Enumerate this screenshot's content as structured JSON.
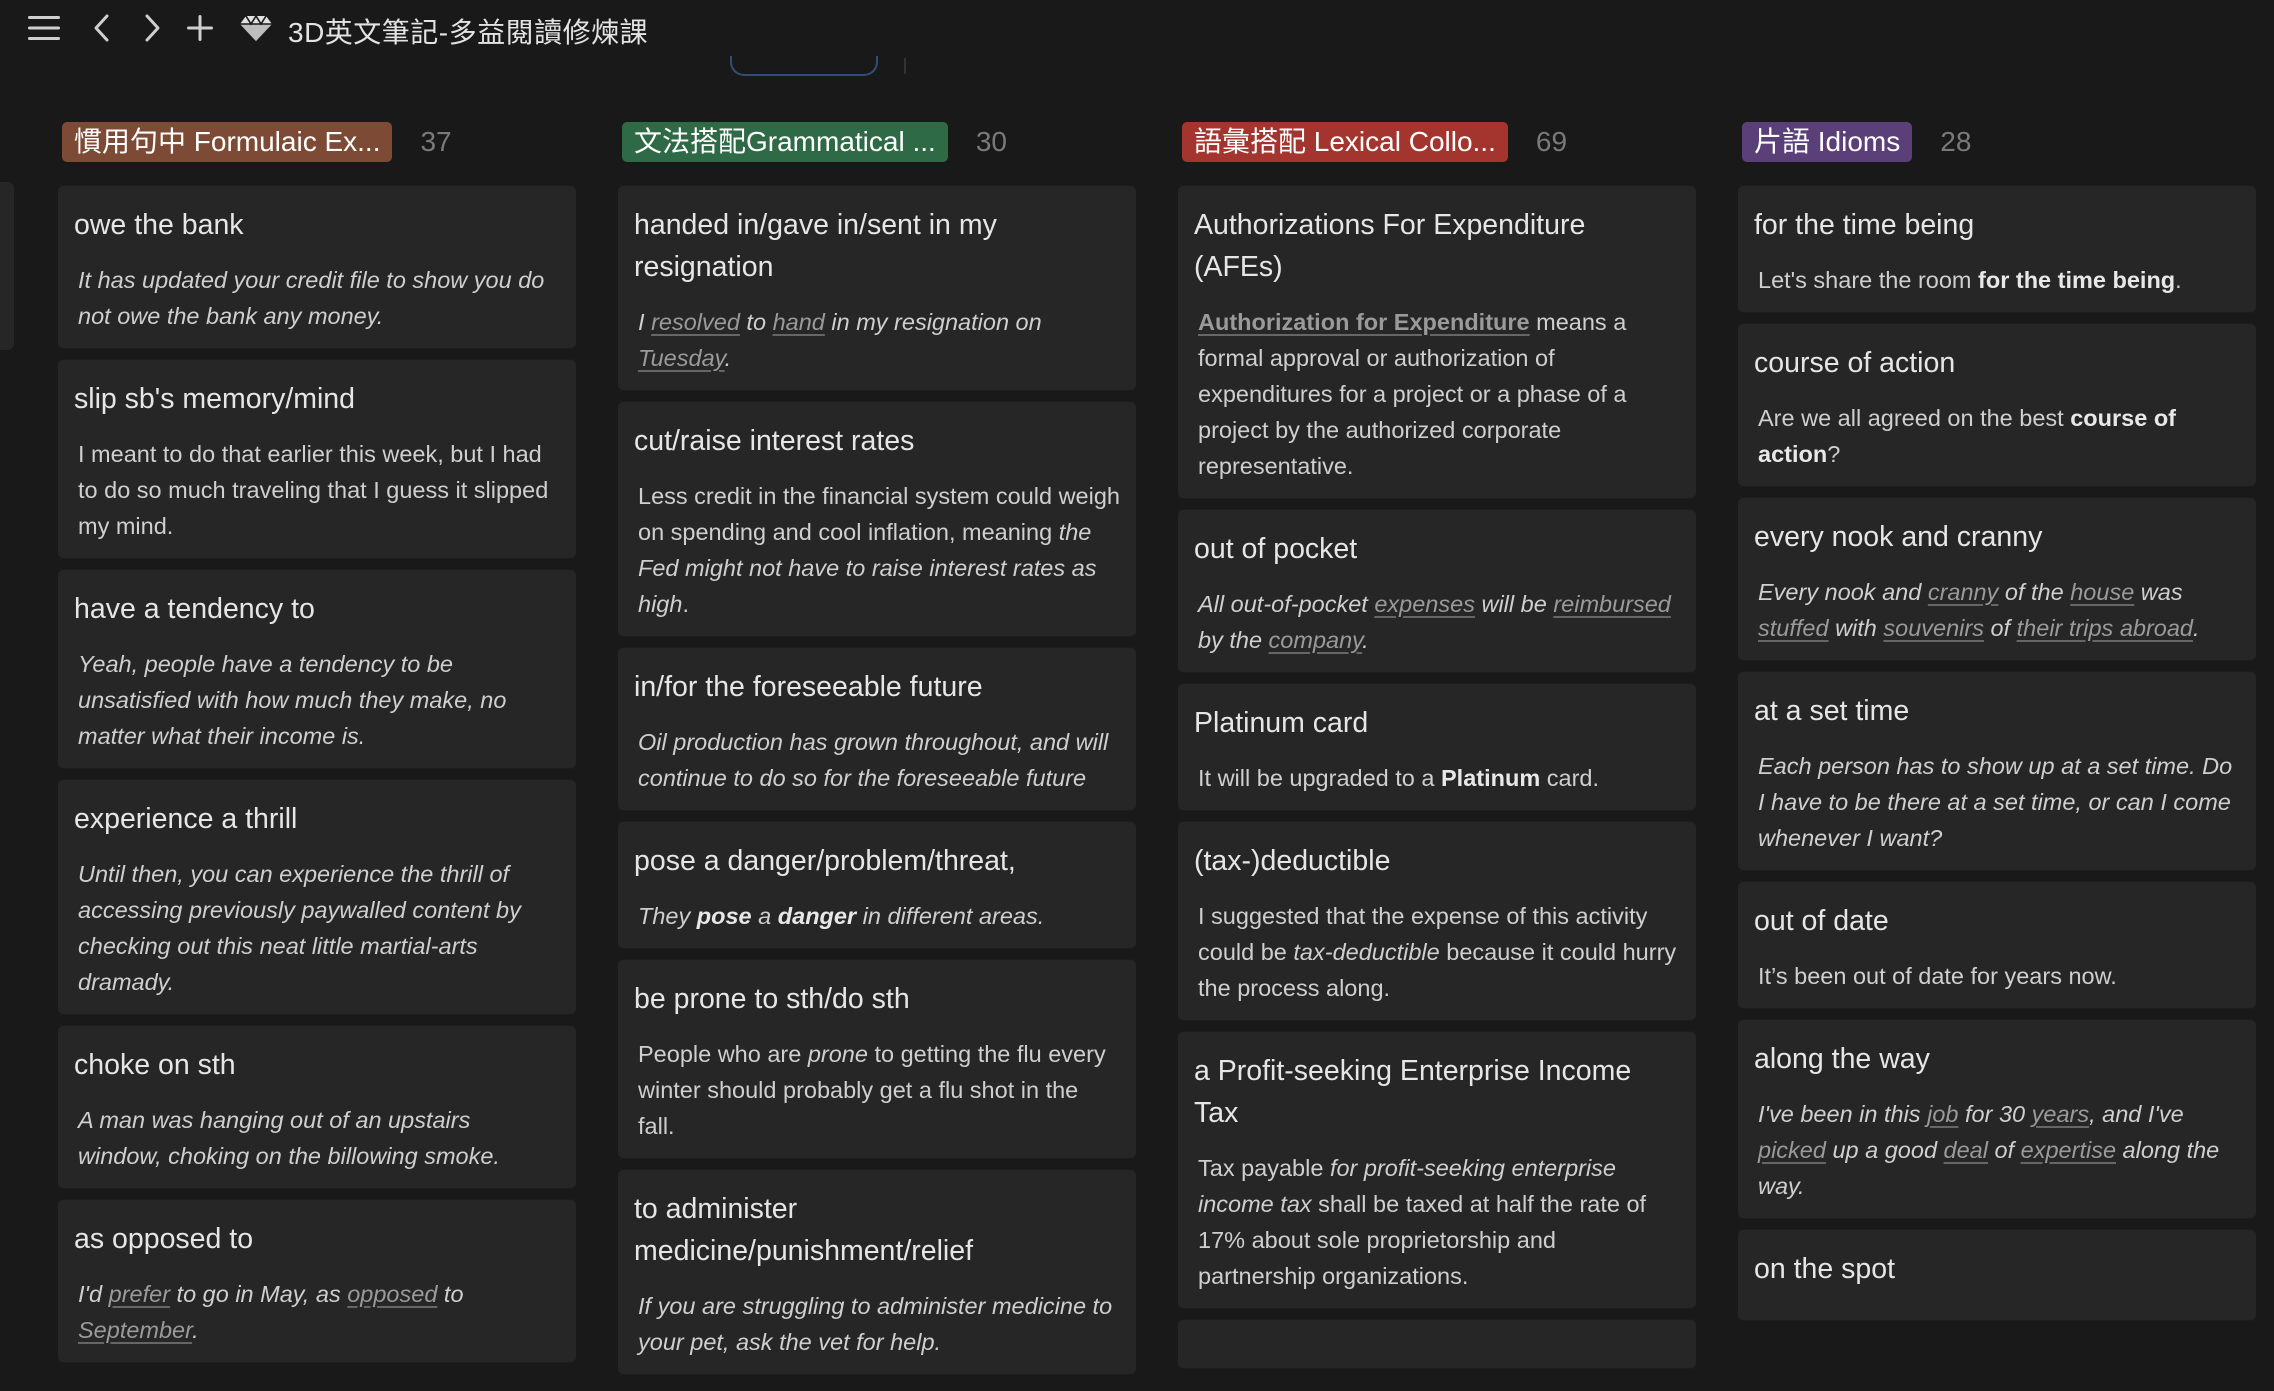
{
  "app": {
    "title": "3D英文筆記-多益閱讀修煉課",
    "menu_icon": "menu-icon",
    "back_icon": "chevron-left-icon",
    "forward_icon": "chevron-right-icon",
    "new_icon": "plus-icon",
    "page_icon": "gem-icon"
  },
  "columns": [
    {
      "tag": "慣用句中 Formulaic Ex...",
      "count": "37",
      "color": "#7d4a36",
      "cards": [
        {
          "title": "owe the bank",
          "style": "italic",
          "body": [
            {
              "t": "It has updated your credit file to show you do not owe the bank any money."
            }
          ]
        },
        {
          "title": "slip sb's memory/mind",
          "style": "plain",
          "body": [
            {
              "t": "I meant to do that earlier this week, but I had to do so much traveling that I guess it slipped my mind."
            }
          ]
        },
        {
          "title": "have a tendency to",
          "style": "italic",
          "body": [
            {
              "t": "Yeah, people have a tendency to be unsatisfied with how much they make, no matter what their income is."
            }
          ]
        },
        {
          "title": "experience a thrill",
          "style": "italic",
          "body": [
            {
              "t": "Until then, you can experience the thrill of accessing previously paywalled content by checking out this neat little martial-arts dramady."
            }
          ]
        },
        {
          "title": "choke on sth",
          "style": "italic",
          "body": [
            {
              "t": "A man was hanging out of an upstairs window, choking on the billowing smoke."
            }
          ]
        },
        {
          "title": "as opposed to",
          "style": "italic",
          "body": [
            {
              "t": "I'd "
            },
            {
              "t": "prefer",
              "f": "u"
            },
            {
              "t": " to go in May, as "
            },
            {
              "t": "opposed",
              "f": "u"
            },
            {
              "t": " to "
            },
            {
              "t": "September",
              "f": "u"
            },
            {
              "t": "."
            }
          ]
        }
      ]
    },
    {
      "tag": "文法搭配Grammatical ...",
      "count": "30",
      "color": "#2f6a46",
      "cards": [
        {
          "title": "handed in/gave in/sent in my resignation",
          "style": "italic",
          "body": [
            {
              "t": "I "
            },
            {
              "t": "resolved",
              "f": "u"
            },
            {
              "t": " to "
            },
            {
              "t": "hand",
              "f": "u"
            },
            {
              "t": " in my resignation on "
            },
            {
              "t": "Tuesday",
              "f": "u"
            },
            {
              "t": "."
            }
          ]
        },
        {
          "title": "cut/raise interest rates",
          "style": "plain",
          "body": [
            {
              "t": "Less credit in the financial system could weigh on spending and cool inflation, meaning "
            },
            {
              "t": "the Fed might not have to raise interest rates as high",
              "f": "i"
            },
            {
              "t": "."
            }
          ]
        },
        {
          "title": "in/for the foreseeable future",
          "style": "italic",
          "body": [
            {
              "t": "Oil production has grown throughout, and will continue to do so for the foreseeable future"
            }
          ]
        },
        {
          "title": "pose a danger/problem/threat,",
          "style": "italic",
          "body": [
            {
              "t": "They "
            },
            {
              "t": "pose",
              "f": "b"
            },
            {
              "t": " a "
            },
            {
              "t": "danger",
              "f": "b"
            },
            {
              "t": " in different areas."
            }
          ]
        },
        {
          "title": "be prone to sth/do sth",
          "style": "plain",
          "body": [
            {
              "t": "People who are "
            },
            {
              "t": "prone",
              "f": "i"
            },
            {
              "t": " to getting the flu every winter should probably get a flu shot in the fall."
            }
          ]
        },
        {
          "title": "to administer medicine/punishment/relief",
          "style": "italic",
          "body": [
            {
              "t": "If you are struggling to administer medicine to your pet, ask the vet for help."
            }
          ]
        }
      ]
    },
    {
      "tag": "語彙搭配 Lexical Collo...",
      "count": "69",
      "color": "#a3352e",
      "cards": [
        {
          "title": "Authorizations For Expenditure (AFEs)",
          "style": "plain",
          "body": [
            {
              "t": "Authorization for Expenditure",
              "f": "ul"
            },
            {
              "t": " means a formal approval or authorization of expenditures for a project or a phase of a project by the authorized corporate representative."
            }
          ]
        },
        {
          "title": "out of pocket",
          "style": "italic",
          "body": [
            {
              "t": "All out-of-pocket "
            },
            {
              "t": "expenses",
              "f": "u"
            },
            {
              "t": " will be "
            },
            {
              "t": "reimbursed",
              "f": "u"
            },
            {
              "t": " by the "
            },
            {
              "t": "company",
              "f": "u"
            },
            {
              "t": "."
            }
          ]
        },
        {
          "title": "Platinum card",
          "style": "plain",
          "body": [
            {
              "t": "It will be upgraded to a "
            },
            {
              "t": "Platinum",
              "f": "b"
            },
            {
              "t": " card."
            }
          ]
        },
        {
          "title": "(tax-)deductible",
          "style": "plain",
          "body": [
            {
              "t": "I suggested that the expense of this activity could be "
            },
            {
              "t": "tax-deductible",
              "f": "i"
            },
            {
              "t": " because it could hurry the process along."
            }
          ]
        },
        {
          "title": "a Profit-seeking Enterprise Income Tax",
          "style": "plain",
          "body": [
            {
              "t": "Tax payable "
            },
            {
              "t": "for profit-seeking enterprise income tax",
              "f": "i"
            },
            {
              "t": " shall be taxed at half the rate of 17% about sole proprietorship and partnership organizations."
            }
          ]
        },
        {
          "title": "",
          "style": "plain",
          "body": [
            {
              "t": ""
            }
          ]
        }
      ]
    },
    {
      "tag": "片語 Idioms",
      "count": "28",
      "color": "#5a3f78",
      "cards": [
        {
          "title": "for the time being",
          "style": "plain",
          "body": [
            {
              "t": "Let's share the room "
            },
            {
              "t": "for the time being",
              "f": "b"
            },
            {
              "t": "."
            }
          ]
        },
        {
          "title": "course of action",
          "style": "plain",
          "body": [
            {
              "t": "Are we all agreed on the best "
            },
            {
              "t": "course of action",
              "f": "b"
            },
            {
              "t": "?"
            }
          ]
        },
        {
          "title": "every nook and cranny",
          "style": "italic",
          "body": [
            {
              "t": "Every nook and "
            },
            {
              "t": "cranny",
              "f": "u"
            },
            {
              "t": " of the "
            },
            {
              "t": "house",
              "f": "u"
            },
            {
              "t": " was "
            },
            {
              "t": "stuffed",
              "f": "u"
            },
            {
              "t": " with "
            },
            {
              "t": "souvenirs",
              "f": "u"
            },
            {
              "t": " of "
            },
            {
              "t": "their trips abroad",
              "f": "u"
            },
            {
              "t": "."
            }
          ]
        },
        {
          "title": "at a set time",
          "style": "italic",
          "body": [
            {
              "t": "Each person has to show up at a set time.  Do I have to be there at a set time, or can I come whenever I want?"
            }
          ]
        },
        {
          "title": "out of date",
          "style": "plain",
          "body": [
            {
              "t": "It’s been out of date for years now."
            }
          ]
        },
        {
          "title": "along the way",
          "style": "italic",
          "body": [
            {
              "t": "I've been in this "
            },
            {
              "t": "job",
              "f": "u"
            },
            {
              "t": " for 30 "
            },
            {
              "t": "years",
              "f": "u"
            },
            {
              "t": ", and I've "
            },
            {
              "t": "picked",
              "f": "u"
            },
            {
              "t": " up a good "
            },
            {
              "t": "deal",
              "f": "u"
            },
            {
              "t": " of "
            },
            {
              "t": "expertise",
              "f": "u"
            },
            {
              "t": " along the way."
            }
          ]
        },
        {
          "title": "on the spot",
          "style": "plain",
          "body": [
            {
              "t": ""
            }
          ]
        }
      ]
    }
  ]
}
